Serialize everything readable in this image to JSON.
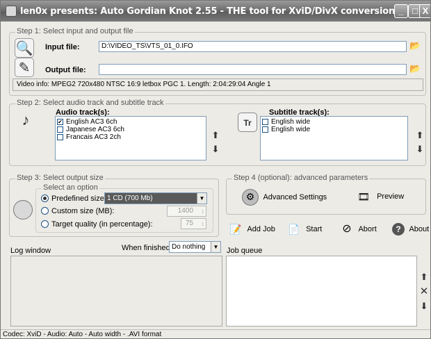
{
  "window": {
    "title": "len0x presents: Auto Gordian Knot 2.55 - THE tool for XviD/DivX conversion.",
    "buttons": {
      "minimize": "_",
      "maximize": "□",
      "close": "X"
    }
  },
  "step1": {
    "legend": "Step 1: Select input and output file",
    "input_label": "Input file:",
    "input_value": "D:\\VIDEO_TS\\VTS_01_0.IFO",
    "output_label": "Output file:",
    "output_value": "",
    "video_info": "Video info: MPEG2 720x480 NTSC 16:9 letbox  PGC 1. Length: 2:04:29:04 Angle 1"
  },
  "step2": {
    "legend": "Step 2: Select audio track and subtitle track",
    "audio_label": "Audio track(s):",
    "audio_tracks": [
      {
        "label": "English AC3 6ch",
        "checked": true
      },
      {
        "label": "Japanese AC3 6ch",
        "checked": false
      },
      {
        "label": "Francais AC3 2ch",
        "checked": false
      }
    ],
    "subtitle_label": "Subtitle track(s):",
    "subtitle_tracks": [
      {
        "label": "English wide",
        "checked": false
      },
      {
        "label": "English wide",
        "checked": false
      }
    ]
  },
  "step3": {
    "legend": "Step 3: Select output size",
    "option_legend": "Select an option",
    "predefined_label": "Predefined size:",
    "predefined_value": "1 CD (700 Mb)",
    "custom_label": "Custom size (MB):",
    "custom_value": "1400",
    "quality_label": "Target quality (in percentage):",
    "quality_value": "75",
    "selected": "predefined"
  },
  "step4": {
    "legend": "Step 4 (optional): advanced parameters",
    "advanced_label": "Advanced Settings",
    "preview_label": "Preview"
  },
  "actions": {
    "add_job": "Add Job",
    "start": "Start",
    "abort": "Abort",
    "about": "About"
  },
  "log": {
    "label": "Log window",
    "when_finished_label": "When finished:",
    "when_finished_value": "Do nothing"
  },
  "queue": {
    "label": "Job queue"
  },
  "status": "Codec: XviD -  Audio: Auto -  Auto width - .AVI format"
}
